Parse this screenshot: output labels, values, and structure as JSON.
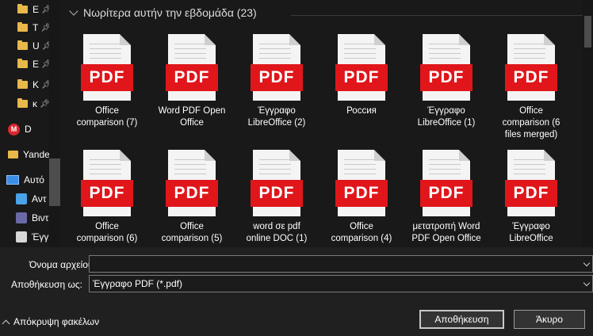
{
  "sidebar": {
    "items": [
      {
        "label": "E",
        "icon": "folder-icon",
        "pinned": true
      },
      {
        "label": "T",
        "icon": "folder-icon",
        "pinned": true
      },
      {
        "label": "U",
        "icon": "folder-icon",
        "pinned": true
      },
      {
        "label": "E",
        "icon": "folder-icon",
        "pinned": true
      },
      {
        "label": "K",
        "icon": "folder-icon",
        "pinned": true
      },
      {
        "label": "κ",
        "icon": "folder-icon",
        "pinned": true
      },
      {
        "label": "D",
        "icon": "mega-icon"
      },
      {
        "label": "Yande",
        "icon": "folder-icon"
      },
      {
        "label": "Αυτό",
        "icon": "computer-icon"
      },
      {
        "label": "Αντ",
        "icon": "cube-icon"
      },
      {
        "label": "Βιντ",
        "icon": "video-icon"
      },
      {
        "label": "Έγγρ",
        "icon": "document-icon"
      }
    ]
  },
  "main": {
    "group_title": "Νωρίτερα αυτήν την εβδομάδα (23)",
    "pdf_badge": "PDF",
    "files": [
      {
        "line1": "Office",
        "line2": "comparison (7)",
        "line3": ""
      },
      {
        "line1": "Word PDF Open",
        "line2": "Office",
        "line3": ""
      },
      {
        "line1": "Έγγραφο",
        "line2": "LibreOffice (2)",
        "line3": ""
      },
      {
        "line1": "Россия",
        "line2": "",
        "line3": ""
      },
      {
        "line1": "Έγγραφο",
        "line2": "LibreOffice (1)",
        "line3": ""
      },
      {
        "line1": "Office",
        "line2": "comparison (6",
        "line3": "files merged)"
      },
      {
        "line1": "Office",
        "line2": "comparison (6)",
        "line3": ""
      },
      {
        "line1": "Office",
        "line2": "comparison (5)",
        "line3": ""
      },
      {
        "line1": "word σε pdf",
        "line2": "online DOC (1)",
        "line3": ""
      },
      {
        "line1": "Office",
        "line2": "comparison (4)",
        "line3": ""
      },
      {
        "line1": "μετατροπή Word",
        "line2": "PDF Open Office",
        "line3": ""
      },
      {
        "line1": "Έγγραφο",
        "line2": "LibreOffice",
        "line3": ""
      }
    ]
  },
  "form": {
    "filename_label": "Όνομα αρχείου:",
    "filename_value": "",
    "savetype_label": "Αποθήκευση ως:",
    "savetype_value": "Έγγραφο PDF (*.pdf)",
    "hide_folders_label": "Απόκρυψη φακέλων",
    "save_button": "Αποθήκευση",
    "cancel_button": "Άκυρο"
  },
  "colors": {
    "background": "#191919",
    "pdf_red": "#e0161b",
    "folder_yellow": "#e8b84a"
  }
}
